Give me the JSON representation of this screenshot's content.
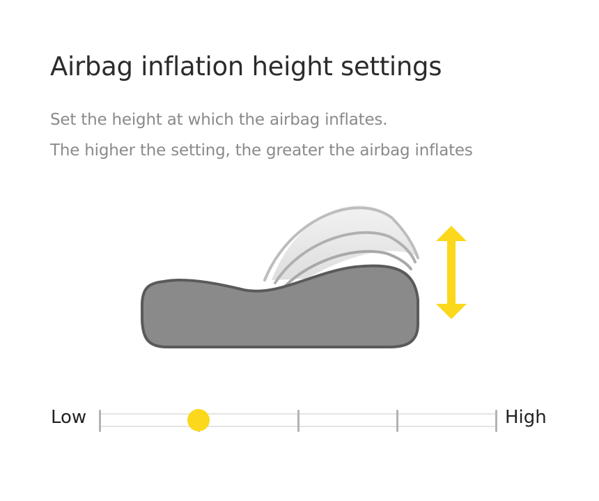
{
  "header": {
    "title": "Airbag inflation height settings"
  },
  "description": {
    "line1": "Set the height at which the airbag inflates.",
    "line2": "The higher the setting, the greater the airbag inflates"
  },
  "slider": {
    "low_label": "Low",
    "high_label": "High",
    "level": 0.25,
    "steps": 5,
    "knob_color": "#fbd81c"
  },
  "illustration": {
    "pillow_color": "#8a8a8a",
    "pillow_outline_color": "#5a5a5a",
    "arrow_color": "#fbd81c",
    "arrow_icon": "up-down-arrow-icon",
    "airbag_icon": "airbag-inflation-waves-icon"
  }
}
